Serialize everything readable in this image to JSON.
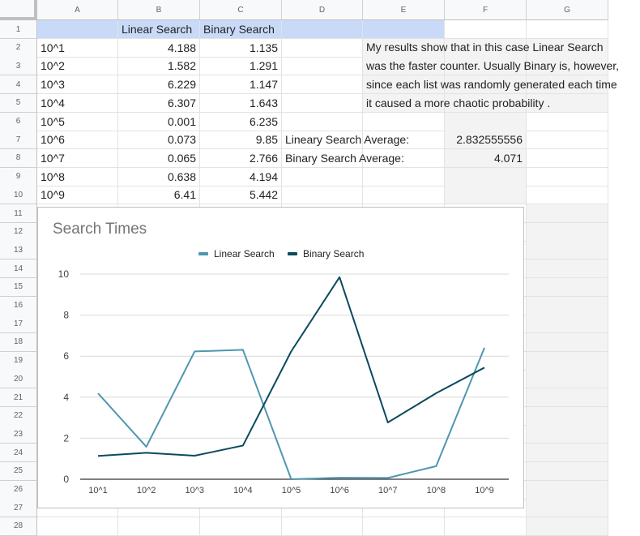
{
  "columns": [
    "A",
    "B",
    "C",
    "D",
    "E",
    "F",
    "G"
  ],
  "rows": [
    "1",
    "2",
    "3",
    "4",
    "5",
    "6",
    "7",
    "8",
    "9",
    "10",
    "11",
    "12",
    "13",
    "14",
    "15",
    "16",
    "17",
    "18",
    "19",
    "20",
    "21",
    "22",
    "23",
    "24",
    "25",
    "26",
    "27",
    "28"
  ],
  "header_row": {
    "b": "Linear Search",
    "c": "Binary Search"
  },
  "data_rows": [
    {
      "a": "10^1",
      "b": "4.188",
      "c": "1.135"
    },
    {
      "a": "10^2",
      "b": "1.582",
      "c": "1.291"
    },
    {
      "a": "10^3",
      "b": "6.229",
      "c": "1.147"
    },
    {
      "a": "10^4",
      "b": "6.307",
      "c": "1.643"
    },
    {
      "a": "10^5",
      "b": "0.001",
      "c": "6.235"
    },
    {
      "a": "10^6",
      "b": "0.073",
      "c": "9.85"
    },
    {
      "a": "10^7",
      "b": "0.065",
      "c": "2.766"
    },
    {
      "a": "10^8",
      "b": "0.638",
      "c": "4.194"
    },
    {
      "a": "10^9",
      "b": "6.41",
      "c": "5.442"
    }
  ],
  "notes": {
    "lines": [
      "My results show that in this case Linear Search",
      "was the faster counter. Usually Binary is, however,",
      "since each list was randomly generated each time",
      "it caused a more chaotic probability ."
    ]
  },
  "averages": {
    "linear_label": "Lineary Search Average:",
    "linear_value": "2.832555556",
    "binary_label": "Binary Search Average:",
    "binary_value": "4.071"
  },
  "colors": {
    "linear": "#4e97b0",
    "binary": "#0b4a5e",
    "header_shade": "#c9daf8"
  },
  "chart_data": {
    "type": "line",
    "title": "Search Times",
    "categories": [
      "10^1",
      "10^2",
      "10^3",
      "10^4",
      "10^5",
      "10^6",
      "10^7",
      "10^8",
      "10^9"
    ],
    "series": [
      {
        "name": "Linear Search",
        "values": [
          4.188,
          1.582,
          6.229,
          6.307,
          0.001,
          0.073,
          0.065,
          0.638,
          6.41
        ]
      },
      {
        "name": "Binary Search",
        "values": [
          1.135,
          1.291,
          1.147,
          1.643,
          6.235,
          9.85,
          2.766,
          4.194,
          5.442
        ]
      }
    ],
    "ylim": [
      0,
      10
    ],
    "yticks": [
      "0",
      "2",
      "4",
      "6",
      "8",
      "10"
    ],
    "grid": true,
    "legend": "top"
  }
}
